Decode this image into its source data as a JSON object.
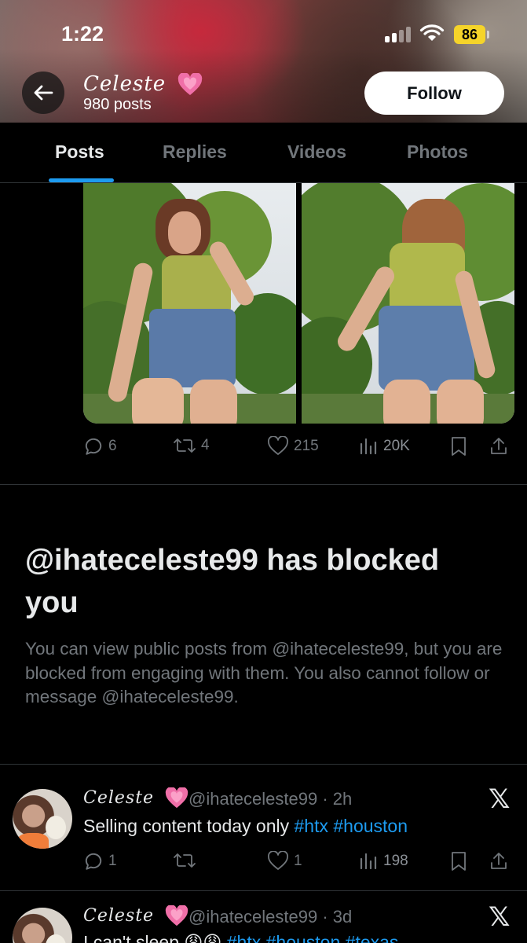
{
  "status_bar": {
    "time": "1:22",
    "battery": "86"
  },
  "header": {
    "profile_name": "Celeste",
    "post_count": "980 posts",
    "follow_label": "Follow"
  },
  "tabs": [
    {
      "label": "Posts",
      "active": true
    },
    {
      "label": "Replies",
      "active": false
    },
    {
      "label": "Videos",
      "active": false
    },
    {
      "label": "Photos",
      "active": false
    }
  ],
  "media_post": {
    "replies": "6",
    "reposts": "4",
    "likes": "215",
    "views": "20K"
  },
  "blocked": {
    "title": "@ihateceleste99 has blocked you",
    "body": "You can view public posts from @ihateceleste99, but you are blocked from engaging with them. You also cannot follow or message @ihateceleste99."
  },
  "tweets": [
    {
      "name": "Celeste",
      "handle_time": "@ihateceleste99 · 2h",
      "text": "Selling content today only",
      "hashtags": "#htx #houston",
      "replies": "1",
      "likes": "1",
      "views": "198"
    },
    {
      "name": "Celeste",
      "handle_time": "@ihateceleste99 · 3d",
      "text": "I can't sleep 😩😩",
      "hashtags": "#htx #houston #texas"
    }
  ],
  "colors": {
    "background": "#000000",
    "text_primary": "#e7e9ea",
    "text_secondary": "#71767b",
    "accent_blue": "#1d9bf0",
    "divider": "#2f3336",
    "battery": "#f5d42a",
    "heart_pink": "#f06fa8"
  },
  "icons": [
    "back-arrow-icon",
    "reply-icon",
    "repost-icon",
    "like-icon",
    "views-icon",
    "bookmark-icon",
    "share-icon",
    "x-logo-icon",
    "pink-heart-emoji"
  ]
}
